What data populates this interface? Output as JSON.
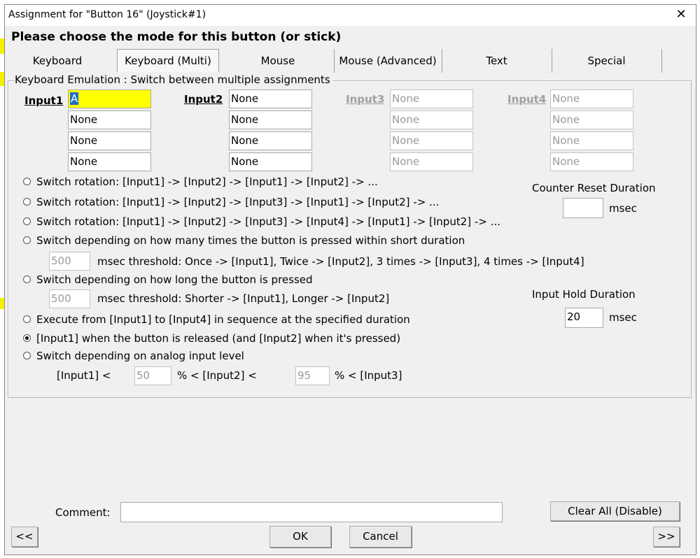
{
  "window": {
    "title": "Assignment for \"Button 16\" (Joystick#1)",
    "close_glyph": "✕",
    "heading": "Please choose the mode for this button (or stick)"
  },
  "tabs": [
    "Keyboard",
    "Keyboard (Multi)",
    "Mouse",
    "Mouse (Advanced)",
    "Text",
    "Special"
  ],
  "active_tab": "Keyboard (Multi)",
  "group": {
    "label": "Keyboard Emulation : Switch between multiple assignments",
    "columns": [
      {
        "label": "Input1",
        "enabled": true,
        "values": [
          "A",
          "None",
          "None",
          "None"
        ]
      },
      {
        "label": "Input2",
        "enabled": true,
        "values": [
          "None",
          "None",
          "None",
          "None"
        ]
      },
      {
        "label": "Input3",
        "enabled": false,
        "values": [
          "None",
          "None",
          "None",
          "None"
        ]
      },
      {
        "label": "Input4",
        "enabled": false,
        "values": [
          "None",
          "None",
          "None",
          "None"
        ]
      }
    ],
    "options": [
      {
        "label": "Switch rotation: [Input1] -> [Input2] -> [Input1] -> [Input2] -> ...",
        "selected": false
      },
      {
        "label": "Switch rotation: [Input1] -> [Input2] -> [Input3] -> [Input1] -> [Input2] -> ...",
        "selected": false
      },
      {
        "label": "Switch rotation: [Input1] -> [Input2] -> [Input3] -> [Input4] -> [Input1] -> [Input2] -> ...",
        "selected": false
      },
      {
        "label": "Switch depending on how many times the button is pressed within short duration",
        "selected": false
      },
      {
        "label": "Switch depending on how long the button is pressed",
        "selected": false
      },
      {
        "label": "Execute from [Input1] to [Input4] in sequence at the specified duration",
        "selected": false
      },
      {
        "label": "[Input1] when the button is released (and [Input2] when it's pressed)",
        "selected": true
      },
      {
        "label": "Switch depending on analog input level",
        "selected": false
      }
    ],
    "press_count": {
      "value": "500",
      "text": "msec threshold: Once -> [Input1], Twice -> [Input2], 3 times -> [Input3], 4 times -> [Input4]"
    },
    "press_length": {
      "value": "500",
      "text": "msec threshold: Shorter -> [Input1], Longer -> [Input2]"
    },
    "counter_reset": {
      "label": "Counter Reset Duration",
      "value": "",
      "unit": "msec"
    },
    "input_hold": {
      "label": "Input Hold Duration",
      "value": "20",
      "unit": "msec"
    },
    "analog": {
      "part1": "[Input1]  <",
      "value1": "50",
      "part2": "%   <  [Input2]  <",
      "value2": "95",
      "part3": "%   <  [Input3]"
    }
  },
  "footer": {
    "comment_label": "Comment:",
    "comment_value": "",
    "clear_label": "Clear All (Disable)",
    "prev_label": "<<",
    "ok_label": "OK",
    "cancel_label": "Cancel",
    "next_label": ">>"
  },
  "colors": {
    "highlight": "#ffff00",
    "selection": "#1f6cc8",
    "dialog_bg": "#f0f0f0"
  }
}
